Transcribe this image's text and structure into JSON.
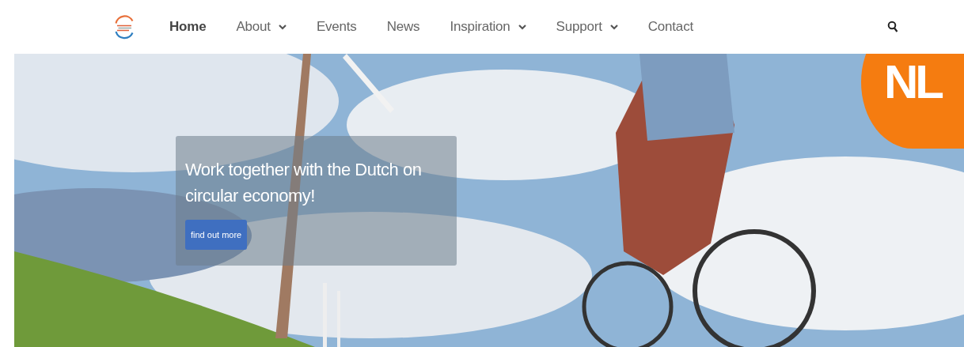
{
  "nav": {
    "items": [
      {
        "label": "Home",
        "selected": true,
        "dropdown": false
      },
      {
        "label": "About",
        "selected": false,
        "dropdown": true
      },
      {
        "label": "Events",
        "selected": false,
        "dropdown": false
      },
      {
        "label": "News",
        "selected": false,
        "dropdown": false
      },
      {
        "label": "Inspiration",
        "selected": false,
        "dropdown": true
      },
      {
        "label": "Support",
        "selected": false,
        "dropdown": true
      },
      {
        "label": "Contact",
        "selected": false,
        "dropdown": false
      }
    ]
  },
  "hero": {
    "kind": "picture",
    "badge": "NL",
    "heading": "Work together with the Dutch on circular economy!",
    "button": "find out more"
  }
}
